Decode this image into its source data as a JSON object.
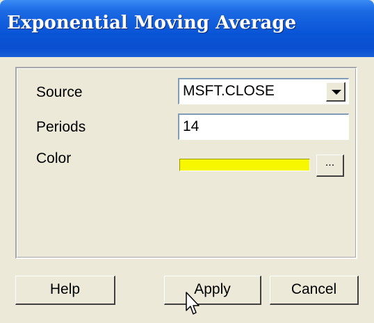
{
  "window": {
    "title": "Exponential Moving Average"
  },
  "form": {
    "source": {
      "label": "Source",
      "value": "MSFT.CLOSE"
    },
    "periods": {
      "label": "Periods",
      "value": "14"
    },
    "color": {
      "label": "Color",
      "value": "#f7f700",
      "picker_label": "..."
    }
  },
  "buttons": {
    "help": "Help",
    "apply": "Apply",
    "cancel": "Cancel"
  },
  "icons": {
    "dropdown": "chevron-down-icon",
    "cursor": "mouse-pointer-icon"
  }
}
